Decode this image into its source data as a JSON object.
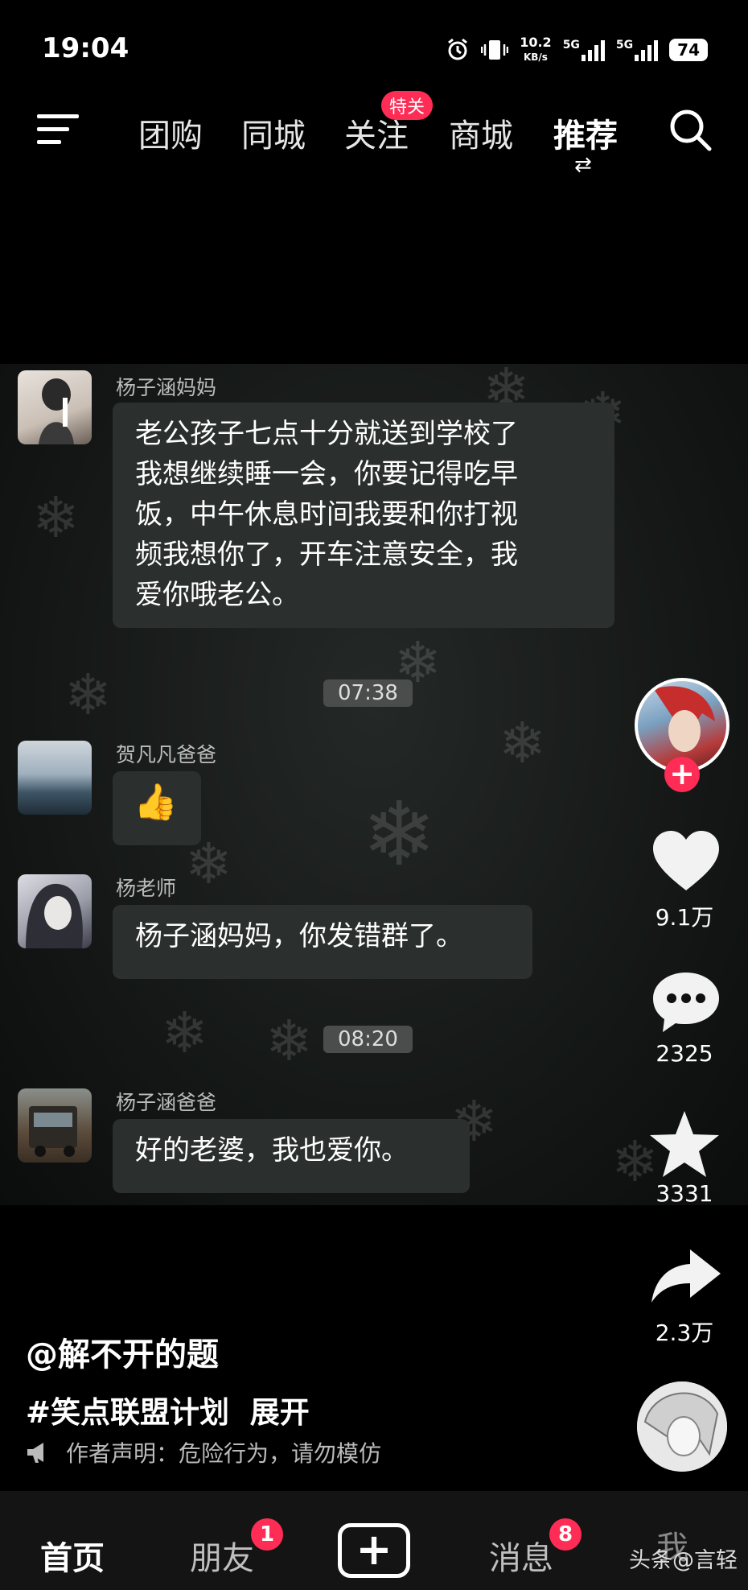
{
  "status_bar": {
    "time": "19:04",
    "net_speed_value": "10.2",
    "net_speed_unit": "KB/s",
    "sim1": "5G",
    "sim2": "5G",
    "battery": "74",
    "icons": [
      "alarm-icon",
      "vibrate-icon",
      "signal-icon",
      "battery-icon"
    ]
  },
  "top_nav": {
    "tabs": [
      "团购",
      "同城",
      "关注",
      "商城",
      "推荐"
    ],
    "active_tab": "推荐",
    "follow_badge": "特关",
    "switch_glyph": "⇄"
  },
  "chat": {
    "messages": [
      {
        "sender": "杨子涵妈妈",
        "lines": [
          "老公孩子七点十分就送到学校了",
          "我想继续睡一会，你要记得吃早",
          "饭，中午休息时间我要和你打视",
          "频我想你了，开车注意安全，我",
          "爱你哦老公。"
        ]
      },
      {
        "time": "07:38"
      },
      {
        "sender": "贺凡凡爸爸",
        "emoji": "👍"
      },
      {
        "sender": "杨老师",
        "lines": [
          "杨子涵妈妈，你发错群了。"
        ]
      },
      {
        "time": "08:20"
      },
      {
        "sender": "杨子涵爸爸",
        "lines": [
          "好的老婆，我也爱你。"
        ]
      }
    ]
  },
  "actions": {
    "follow_plus": "+",
    "likes": "9.1万",
    "comments": "2325",
    "favorites": "3331",
    "shares": "2.3万"
  },
  "caption": {
    "author": "@解不开的题",
    "hashtag": "#笑点联盟计划",
    "expand": "展开",
    "declaration": "作者声明：危险行为，请勿模仿"
  },
  "bottom_nav": {
    "home": "首页",
    "friends": "朋友",
    "friends_badge": "1",
    "plus": "+",
    "messages": "消息",
    "messages_badge": "8",
    "me": "我"
  },
  "watermark": "头条@言轻",
  "colors": {
    "accent": "#ff2c55",
    "bubble": "#2b2f2e",
    "background": "#000000"
  }
}
